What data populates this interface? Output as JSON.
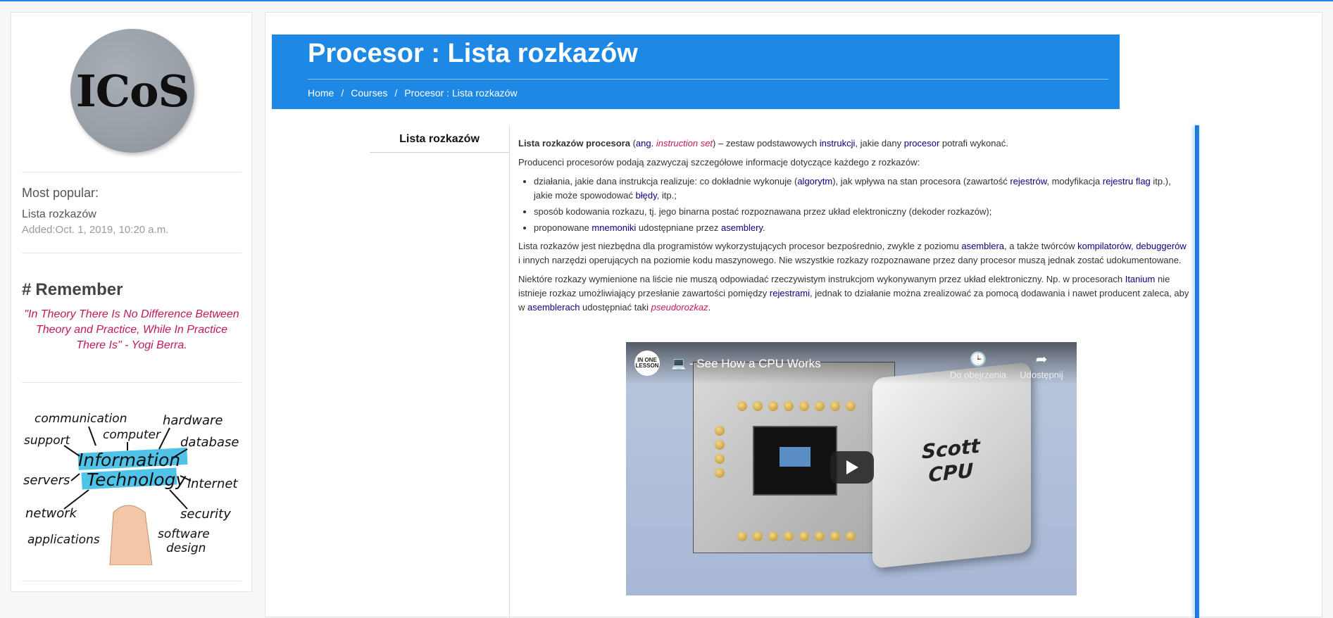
{
  "sidebar": {
    "logo_text": "ICoS",
    "most_popular_title": "Most popular:",
    "popular_item": "Lista rozkazów",
    "popular_date": "Added:Oct. 1, 2019, 10:20 a.m.",
    "remember_title": "Remember",
    "quote": "\"In Theory There Is No Difference Between Theory and Practice, While In Practice There Is\" - Yogi Berra.",
    "image_words": {
      "communication": "communication",
      "hardware": "hardware",
      "support": "support",
      "computer": "computer",
      "database": "database",
      "information": "Information",
      "technology": "Technology",
      "servers": "servers",
      "internet": "internet",
      "network": "network",
      "security": "security",
      "applications": "applications",
      "software": "software",
      "design": "design"
    }
  },
  "banner": {
    "title": "Procesor : Lista rozkazów",
    "breadcrumbs": [
      "Home",
      "Courses",
      "Procesor : Lista rozkazów"
    ],
    "separator": "/"
  },
  "tab": {
    "label": "Lista rozkazów"
  },
  "article": {
    "p1": {
      "bold": "Lista rozkazów procesora",
      "open": " (",
      "ang": "ang.",
      "term": "instruction set",
      "mid": ") – zestaw podstawowych ",
      "instr": "instrukcji",
      "mid2": ", jakie dany ",
      "proc": "procesor",
      "end": " potrafi wykonać."
    },
    "p2": "Producenci procesorów podają zazwyczaj szczegółowe informacje dotyczące każdego z rozkazów:",
    "li1": {
      "a": "działania, jakie dana instrukcja realizuje: co dokładnie wykonuje (",
      "alg": "algorytm",
      "b": "), jak wpływa na stan procesora (zawartość ",
      "rej": "rejestrów",
      "c": ", modyfikacja ",
      "rejflag": "rejestru flag",
      "d": " itp.), jakie może spowodować ",
      "bledy": "błędy",
      "e": ", itp.;"
    },
    "li2": "sposób kodowania rozkazu, tj. jego binarna postać rozpoznawana przez układ elektroniczny (dekoder rozkazów);",
    "li3": {
      "a": "proponowane ",
      "mnem": "mnemoniki",
      "b": " udostępniane przez ",
      "asm": "asemblery",
      "c": "."
    },
    "p3": {
      "a": "Lista rozkazów jest niezbędna dla programistów wykorzystujących procesor bezpośrednio, zwykle z poziomu ",
      "asm": "asemblera",
      "b": ", a także twórców ",
      "komp": "kompilatorów",
      "c": ", ",
      "debug": "debuggerów",
      "d": " i innych narzędzi operujących na poziomie kodu maszynowego. Nie wszystkie rozkazy rozpoznawane przez dany procesor muszą jednak zostać udokumentowane."
    },
    "p4": {
      "a": "Niektóre rozkazy wymienione na liście nie muszą odpowiadać rzeczywistym instrukcjom wykonywanym przez układ elektroniczny. Np. w procesorach ",
      "itan": "Itanium",
      "b": " nie istnieje rozkaz umożliwiający przesłanie zawartości pomiędzy ",
      "rej": "rejestrami",
      "c": ", jednak to działanie można zrealizować za pomocą dodawania i nawet producent zaleca, aby w ",
      "asm": "asemblerach",
      "d": " udostępniać taki ",
      "pseudo": "pseudorozkaz",
      "e": "."
    }
  },
  "video": {
    "channel": "IN ONE LESSON",
    "title": "💻 - See How a CPU Works",
    "watch_later": "Do obejrzenia",
    "share": "Udostępnij",
    "cpu_label_1": "Scott",
    "cpu_label_2": "CPU"
  },
  "colors": {
    "accent": "#1e88e5",
    "link": "#0b0080",
    "quote": "#c2185b"
  }
}
